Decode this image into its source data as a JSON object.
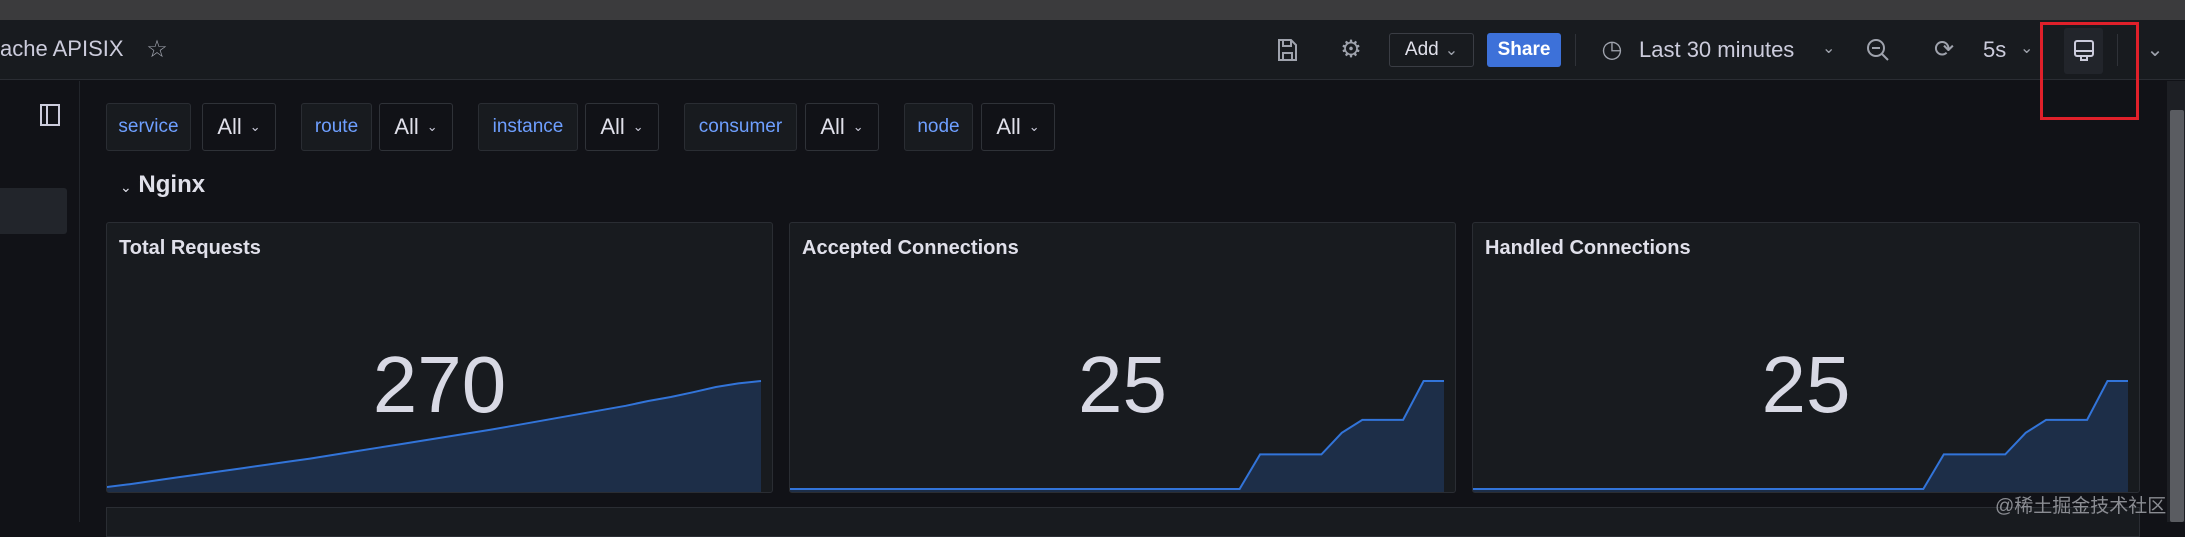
{
  "header": {
    "title": "ache APISIX",
    "add_label": "Add",
    "share_label": "Share",
    "time_range": "Last 30 minutes",
    "refresh_interval": "5s"
  },
  "colors": {
    "accent": "#3d71d9",
    "series": "#3274d9",
    "highlight": "#e0202a"
  },
  "variables": [
    {
      "label": "service",
      "value": "All"
    },
    {
      "label": "route",
      "value": "All"
    },
    {
      "label": "instance",
      "value": "All"
    },
    {
      "label": "consumer",
      "value": "All"
    },
    {
      "label": "node",
      "value": "All"
    }
  ],
  "row": {
    "title": "Nginx"
  },
  "panels": [
    {
      "title": "Total Requests",
      "value": "270",
      "spark": [
        5,
        12,
        20,
        28,
        36,
        44,
        52,
        60,
        68,
        76,
        85,
        94,
        103,
        112,
        121,
        130,
        139,
        148,
        158,
        168,
        178,
        188,
        198,
        208,
        220,
        230,
        242,
        255,
        264,
        270
      ]
    },
    {
      "title": "Accepted Connections",
      "value": "25",
      "spark": [
        0,
        0,
        0,
        0,
        0,
        0,
        0,
        0,
        0,
        0,
        0,
        0,
        0,
        0,
        0,
        0,
        0,
        0,
        0,
        0,
        0,
        0,
        0,
        8,
        8,
        8,
        8,
        13,
        16,
        16,
        16,
        25,
        25
      ]
    },
    {
      "title": "Handled Connections",
      "value": "25",
      "spark": [
        0,
        0,
        0,
        0,
        0,
        0,
        0,
        0,
        0,
        0,
        0,
        0,
        0,
        0,
        0,
        0,
        0,
        0,
        0,
        0,
        0,
        0,
        0,
        8,
        8,
        8,
        8,
        13,
        16,
        16,
        16,
        25,
        25
      ]
    }
  ],
  "watermark": "@稀土掘金技术社区"
}
